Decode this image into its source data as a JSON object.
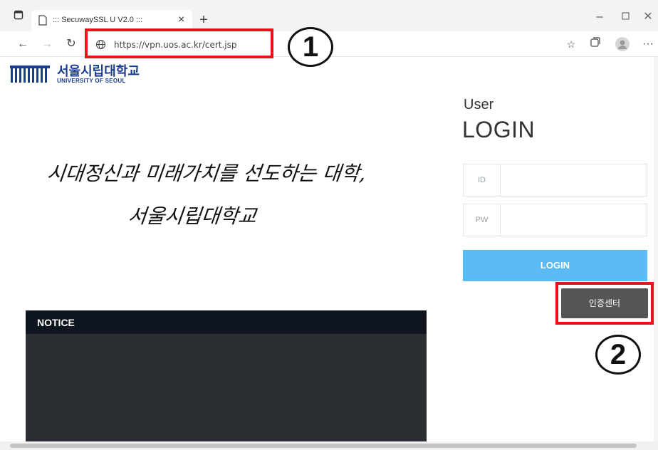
{
  "browser": {
    "tab_title": "::: SecuwaySSL U V2.0 :::",
    "url": "https://vpn.uos.ac.kr/cert.jsp",
    "icons": [
      "tab-actions-icon",
      "page-icon",
      "close-icon",
      "plus-icon",
      "back-icon",
      "forward-icon",
      "refresh-icon",
      "globe-icon",
      "favorites-icon",
      "collections-icon",
      "profile-icon",
      "more-icon",
      "minimize-icon",
      "maximize-icon",
      "window-close-icon"
    ]
  },
  "university": {
    "name_ko": "서울시립대학교",
    "name_en": "UNIVERSITY OF SEOUL"
  },
  "slogan": {
    "line1": "시대정신과 미래가치를 선도하는 대학,",
    "line2": "서울시립대학교"
  },
  "login": {
    "user_label": "User",
    "title": "LOGIN",
    "id_label": "ID",
    "pw_label": "PW",
    "login_button": "LOGIN",
    "cert_button": "인증센터"
  },
  "notice": {
    "title": "NOTICE"
  },
  "annotations": {
    "marker1": "1",
    "marker2": "2"
  },
  "colors": {
    "login_button": "#5bbcf5",
    "cert_button": "#555555",
    "annotation_red": "#e8141d",
    "notice_bg": "#2b2e33",
    "logo_blue": "#1a3c8c"
  }
}
